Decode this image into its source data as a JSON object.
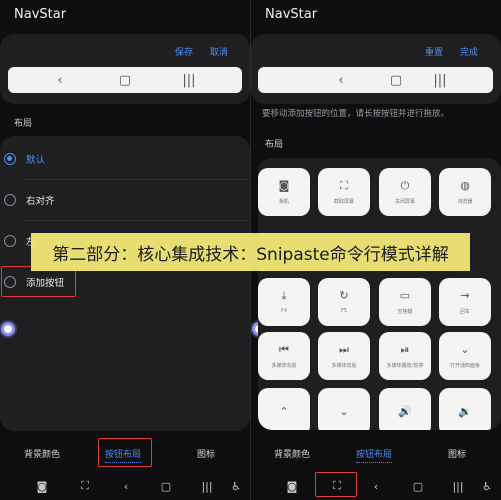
{
  "left": {
    "title": "NavStar",
    "actions": [
      "保存",
      "取消"
    ],
    "section_label": "布局",
    "options": [
      {
        "label": "默认",
        "selected": true
      },
      {
        "label": "右对齐",
        "selected": false
      },
      {
        "label": "左",
        "selected": false
      },
      {
        "label": "添加按钮",
        "selected": false
      }
    ],
    "tabs": [
      "背景颜色",
      "按钮布局",
      "图标"
    ],
    "active_tab": "按钮布局"
  },
  "right": {
    "title": "NavStar",
    "actions": [
      "重置",
      "完成"
    ],
    "hint": "要移动添加按钮的位置，请长按按钮并进行拖放。",
    "section_label": "布局",
    "tiles": [
      {
        "label": "相机",
        "icon": "camera-icon"
      },
      {
        "label": "截取屏幕",
        "icon": "screenshot-icon"
      },
      {
        "label": "关闭屏幕",
        "icon": "power-icon"
      },
      {
        "label": "浏览器",
        "icon": "globe-icon"
      },
      {
        "label": "F4",
        "icon": "download-icon"
      },
      {
        "label": "F5",
        "icon": "refresh-icon"
      },
      {
        "label": "空格键",
        "icon": "space-icon"
      },
      {
        "label": "回车",
        "icon": "arrow-right-icon"
      },
      {
        "label": "多媒体向前",
        "icon": "rewind-icon"
      },
      {
        "label": "多媒体向后",
        "icon": "fast-forward-icon"
      },
      {
        "label": "多媒体播放/暂停",
        "icon": "play-pause-icon"
      },
      {
        "label": "打开通知面板",
        "icon": "chevron-down-icon"
      },
      {
        "label": "",
        "icon": "chevron-up-icon"
      },
      {
        "label": "",
        "icon": "chevron-down-icon"
      },
      {
        "label": "",
        "icon": "volume-up-icon"
      },
      {
        "label": "",
        "icon": "volume-down-icon"
      }
    ],
    "tabs": [
      "背景颜色",
      "按钮布局",
      "图标"
    ],
    "active_tab": "按钮布局"
  },
  "banner": {
    "text": "第二部分：核心集成技术：Snipaste命令行模式详解"
  },
  "colors": {
    "accent": "#4d8df2",
    "highlight": "#e23b3b",
    "banner": "#faee78"
  }
}
